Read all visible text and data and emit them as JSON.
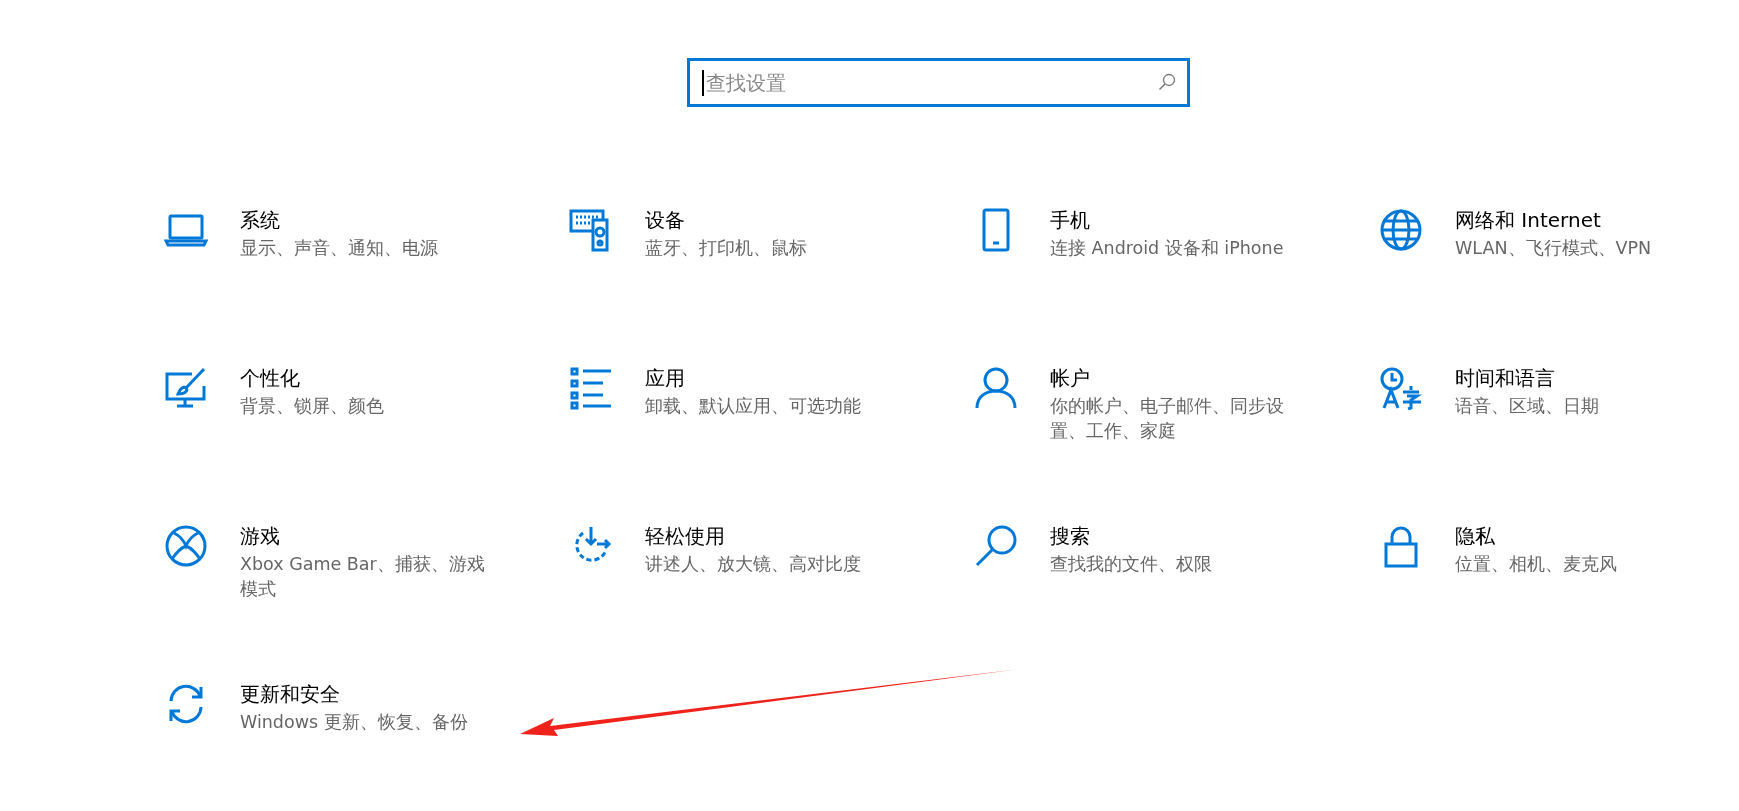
{
  "search": {
    "placeholder": "查找设置"
  },
  "categories": [
    {
      "title": "系统",
      "description": "显示、声音、通知、电源"
    },
    {
      "title": "设备",
      "description": "蓝牙、打印机、鼠标"
    },
    {
      "title": "手机",
      "description": "连接 Android 设备和 iPhone"
    },
    {
      "title": "网络和 Internet",
      "description": "WLAN、飞行模式、VPN"
    },
    {
      "title": "个性化",
      "description": "背景、锁屏、颜色"
    },
    {
      "title": "应用",
      "description": "卸载、默认应用、可选功能"
    },
    {
      "title": "帐户",
      "description": "你的帐户、电子邮件、同步设置、工作、家庭"
    },
    {
      "title": "时间和语言",
      "description": "语音、区域、日期"
    },
    {
      "title": "游戏",
      "description": "Xbox Game Bar、捕获、游戏模式"
    },
    {
      "title": "轻松使用",
      "description": "讲述人、放大镜、高对比度"
    },
    {
      "title": "搜索",
      "description": "查找我的文件、权限"
    },
    {
      "title": "隐私",
      "description": "位置、相机、麦克风"
    },
    {
      "title": "更新和安全",
      "description": "Windows 更新、恢复、备份"
    }
  ]
}
